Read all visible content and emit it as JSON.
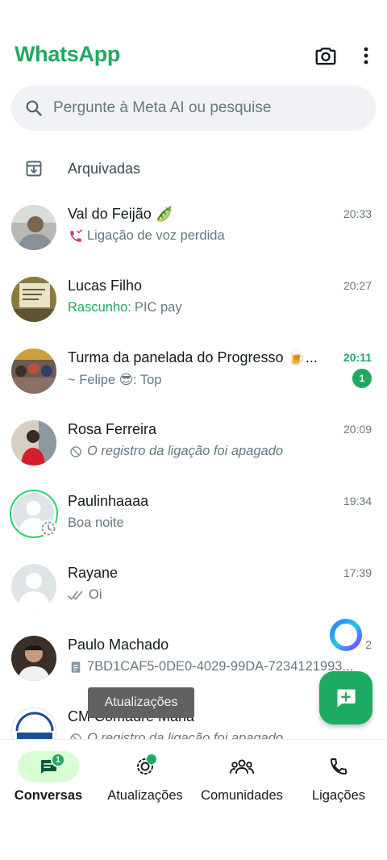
{
  "header": {
    "title": "WhatsApp",
    "camera_icon": "camera-icon",
    "more_icon": "more-vert-icon"
  },
  "search": {
    "placeholder": "Pergunte à Meta AI ou pesquise"
  },
  "archived": {
    "label": "Arquivadas"
  },
  "chats": [
    {
      "name": "Val do Feijão 🫛",
      "time": "20:33",
      "preview": "Ligação de voz perdida",
      "preview_icon": "missed-call-icon"
    },
    {
      "name": "Lucas Filho",
      "time": "20:27",
      "draft_label": "Rascunho:",
      "preview": "PIC pay"
    },
    {
      "name": "Turma da panelada do Progresso 🍺...",
      "time": "20:11",
      "preview": "~ Felipe 😎: Top",
      "unread": "1"
    },
    {
      "name": "Rosa Ferreira",
      "time": "20:09",
      "preview": "O registro da ligação foi apagado",
      "preview_icon": "blocked-icon"
    },
    {
      "name": "Paulinhaaaa",
      "time": "19:34",
      "preview": "Boa noite"
    },
    {
      "name": "Rayane",
      "time": "17:39",
      "preview": "Oi",
      "preview_icon": "double-check-icon"
    },
    {
      "name": "Paulo Machado",
      "time": "2",
      "preview": "7BD1CAF5-0DE0-4029-99DA-7234121993...",
      "preview_icon": "document-icon"
    },
    {
      "name": "CM Comadre Maria",
      "time": "",
      "preview": "O registro da ligação foi apagado",
      "preview_icon": "blocked-icon"
    }
  ],
  "toast": {
    "text": "Atualizações"
  },
  "fab": {
    "icon": "new-chat-icon"
  },
  "nav": {
    "items": [
      {
        "label": "Conversas",
        "badge": "1"
      },
      {
        "label": "Atualizações"
      },
      {
        "label": "Comunidades"
      },
      {
        "label": "Ligações"
      }
    ]
  },
  "colors": {
    "brand": "#1daa61",
    "active_pill": "#d8fdd2",
    "muted": "#667781"
  }
}
